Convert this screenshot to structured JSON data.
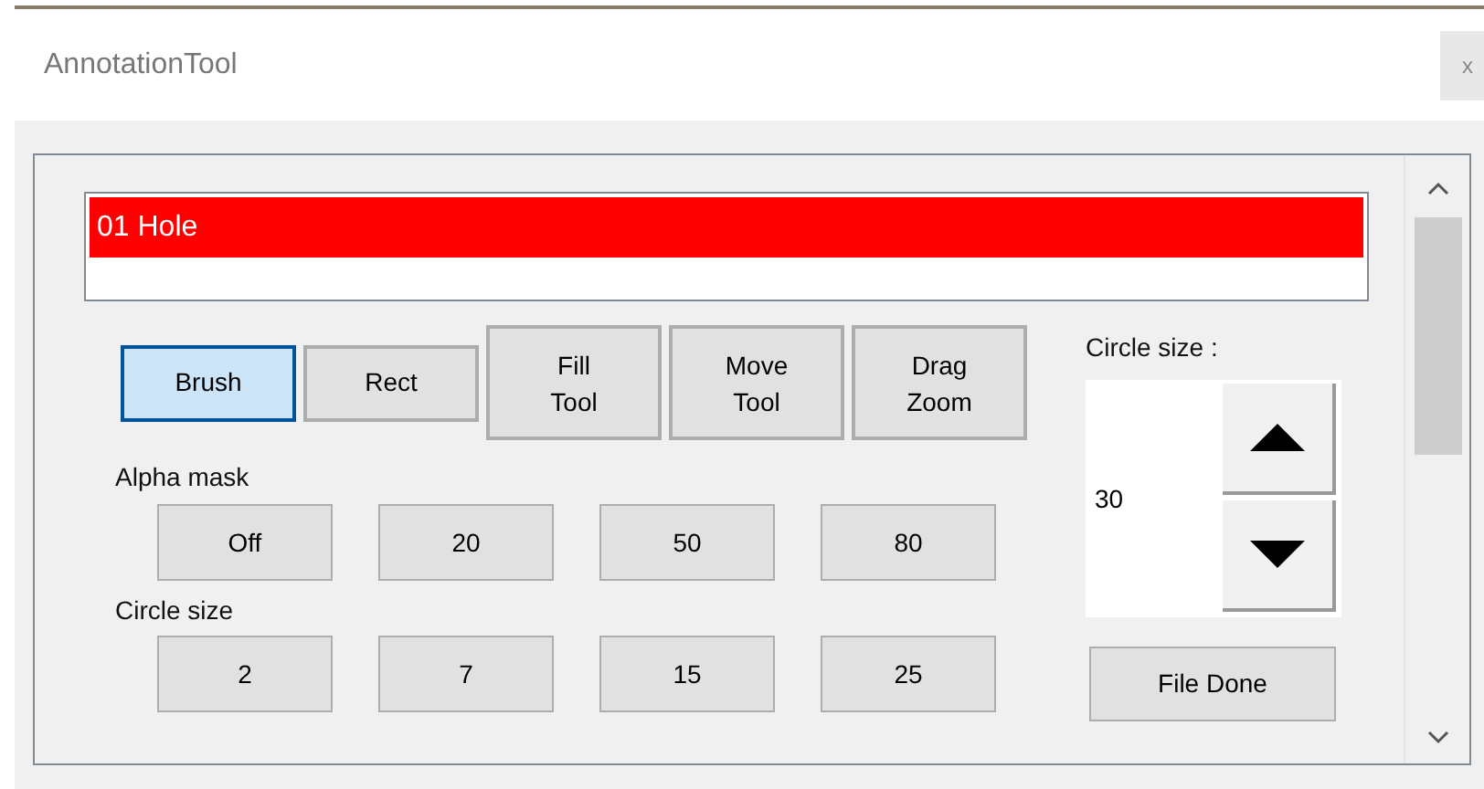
{
  "window": {
    "title": "AnnotationTool",
    "close_label": "x"
  },
  "labels": [
    {
      "name": "01 Hole",
      "selected": true
    }
  ],
  "tools": [
    {
      "label": "Brush",
      "selected": true
    },
    {
      "label": "Rect",
      "selected": false
    },
    {
      "label": "Fill\nTool",
      "selected": false
    },
    {
      "label": "Move\nTool",
      "selected": false
    },
    {
      "label": "Drag\nZoom",
      "selected": false
    }
  ],
  "alpha_mask": {
    "label": "Alpha mask",
    "buttons": [
      "Off",
      "20",
      "50",
      "80"
    ]
  },
  "circle_size": {
    "label": "Circle size",
    "buttons": [
      "2",
      "7",
      "15",
      "25"
    ]
  },
  "circle_size_spinner": {
    "label": "Circle size :",
    "value": "30"
  },
  "file_done": "File Done"
}
